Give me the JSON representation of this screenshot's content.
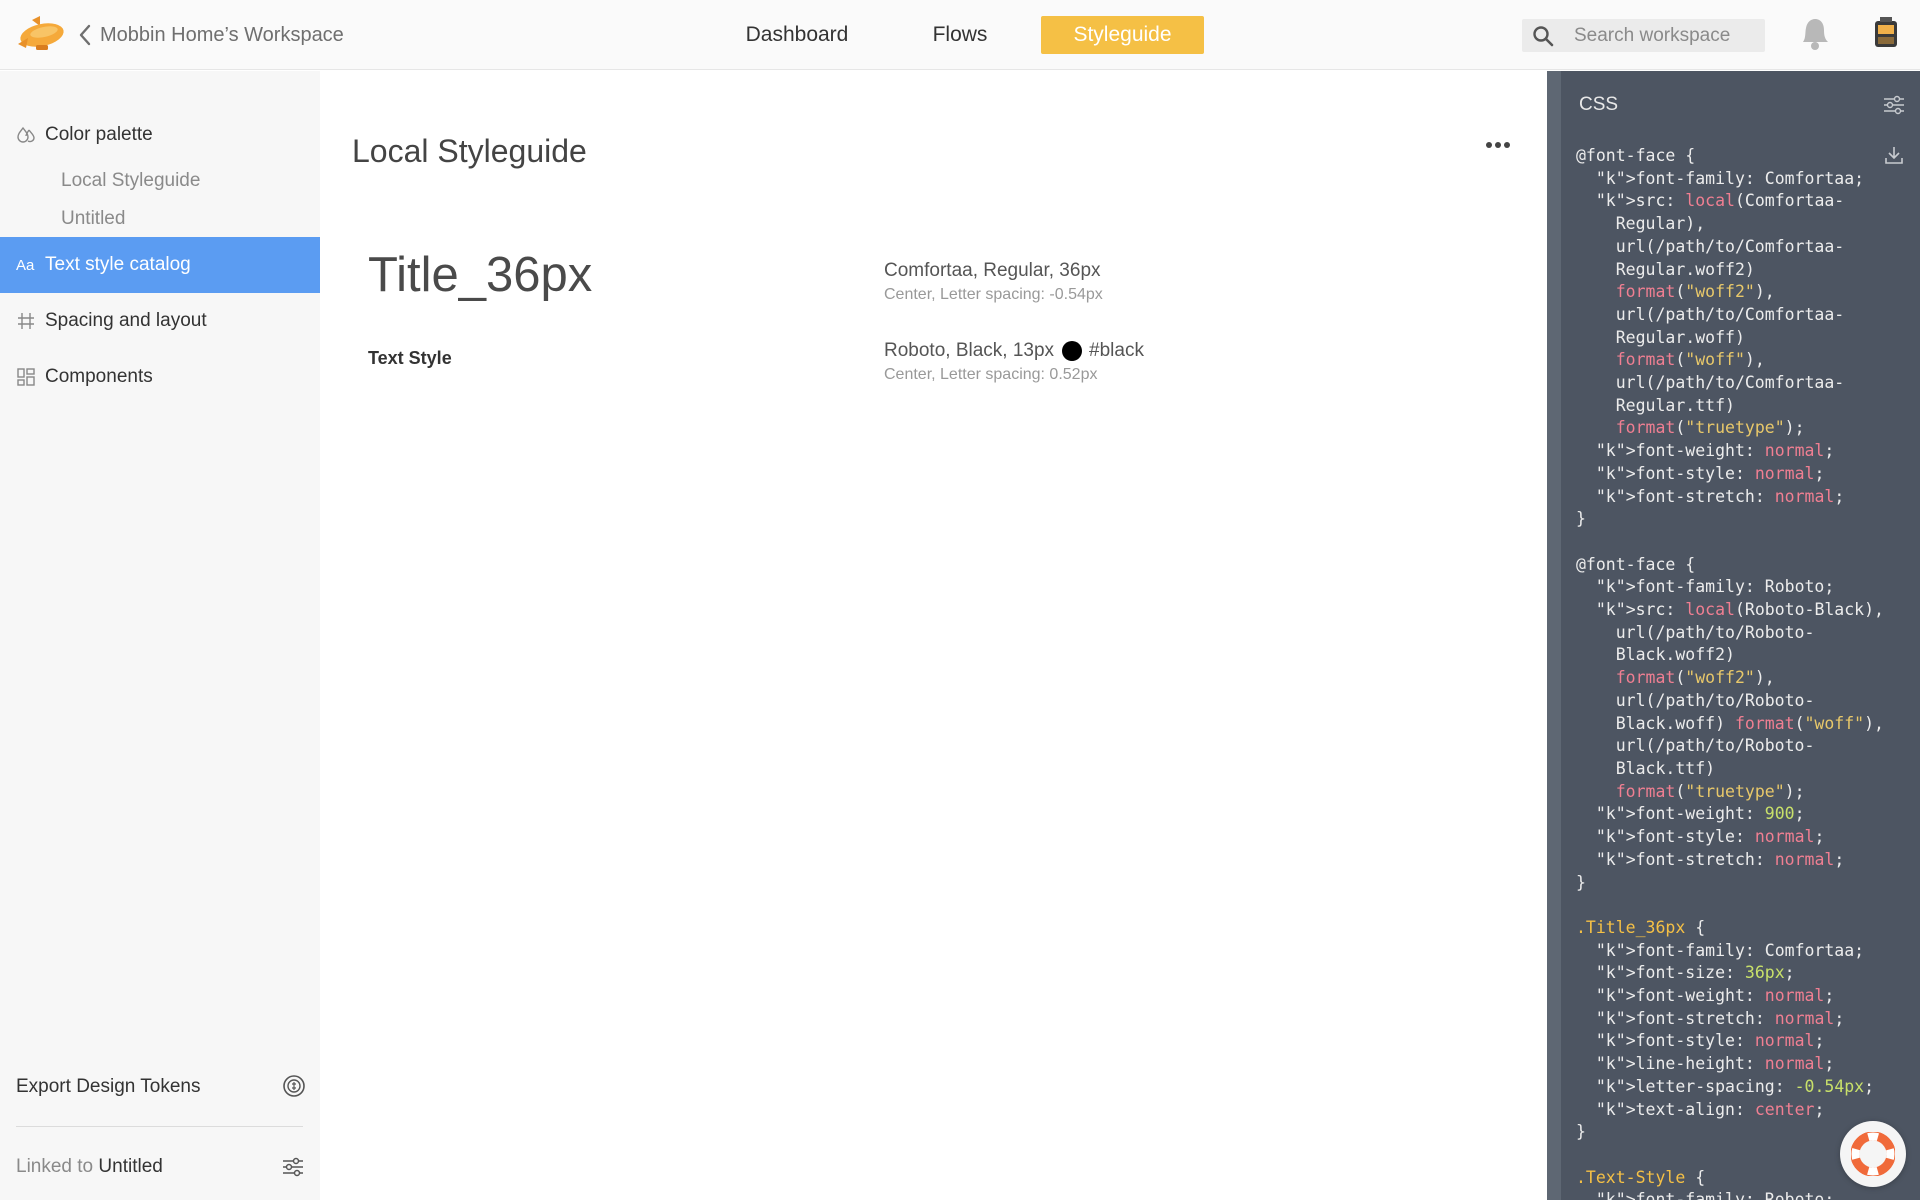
{
  "header": {
    "back_label": "Mobbin Home’s Workspace",
    "tabs": [
      "Dashboard",
      "Flows",
      "Styleguide"
    ],
    "active_tab": "Styleguide",
    "search_placeholder": "Search workspace"
  },
  "sidebar": {
    "items": [
      {
        "label": "Color palette",
        "icon": "droplets-icon"
      },
      {
        "label": "Text style catalog",
        "icon": "text-aa-icon",
        "active": true
      },
      {
        "label": "Spacing and layout",
        "icon": "grid-spacing-icon"
      },
      {
        "label": "Components",
        "icon": "components-icon"
      }
    ],
    "subitems": [
      "Local Styleguide",
      "Untitled"
    ],
    "export_label": "Export Design Tokens",
    "linked_prefix": "Linked to",
    "linked_name": "Untitled"
  },
  "main": {
    "title": "Local Styleguide",
    "styles": [
      {
        "name": "Title_36px",
        "desc": "Comfortaa, Regular, 36px",
        "meta": "Center, Letter spacing: -0.54px"
      },
      {
        "name": "Text Style",
        "desc": "Roboto, Black, 13px",
        "color_name": "#black",
        "meta": "Center, Letter spacing: 0.52px"
      }
    ]
  },
  "css_panel": {
    "title": "CSS",
    "code": [
      "@font-face {",
      "  font-family: Comfortaa;",
      "  src: local(Comfortaa-",
      "    Regular),",
      "    url(/path/to/Comfortaa-",
      "    Regular.woff2)",
      "    format(\"woff2\"),",
      "    url(/path/to/Comfortaa-",
      "    Regular.woff)",
      "    format(\"woff\"),",
      "    url(/path/to/Comfortaa-",
      "    Regular.ttf)",
      "    format(\"truetype\");",
      "  font-weight: normal;",
      "  font-style: normal;",
      "  font-stretch: normal;",
      "}",
      "",
      "@font-face {",
      "  font-family: Roboto;",
      "  src: local(Roboto-Black),",
      "    url(/path/to/Roboto-",
      "    Black.woff2)",
      "    format(\"woff2\"),",
      "    url(/path/to/Roboto-",
      "    Black.woff) format(\"woff\"),",
      "    url(/path/to/Roboto-",
      "    Black.ttf)",
      "    format(\"truetype\");",
      "  font-weight: 900;",
      "  font-style: normal;",
      "  font-stretch: normal;",
      "}",
      "",
      ".Title_36px {",
      "  font-family: Comfortaa;",
      "  font-size: 36px;",
      "  font-weight: normal;",
      "  font-stretch: normal;",
      "  font-style: normal;",
      "  line-height: normal;",
      "  letter-spacing: -0.54px;",
      "  text-align: center;",
      "}",
      "",
      ".Text-Style {",
      "  font-family: Roboto;"
    ]
  },
  "colors": {
    "accent": "#f5c045",
    "active_sidebar": "#5b9cf2",
    "code_bg": "#4d5562",
    "code_property": "#6ec6ee",
    "code_value": "#f07f92",
    "code_string": "#e8c86a",
    "code_number": "#c8e06a"
  }
}
